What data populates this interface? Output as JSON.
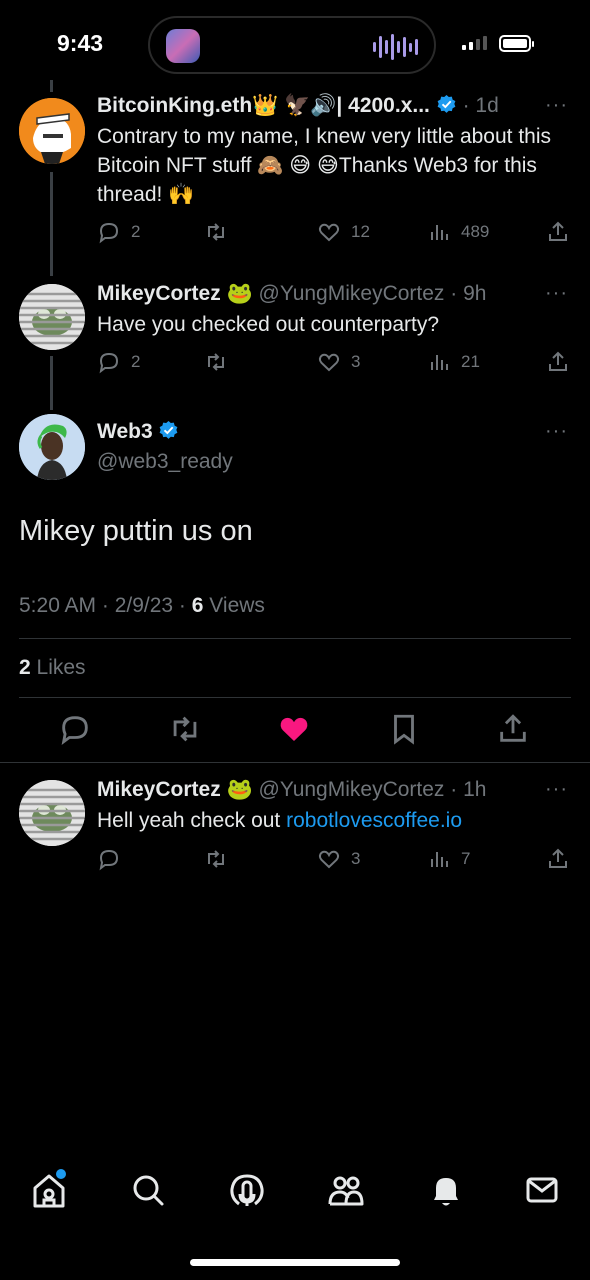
{
  "status_bar": {
    "time": "9:43"
  },
  "tweets": [
    {
      "name": "BitcoinKing.eth👑 🦅🔊| 4200.x...",
      "age": "· 1d",
      "text": "Contrary to my name, I knew very little about this Bitcoin NFT stuff 🙈 😅 😅Thanks Web3 for this thread! 🙌",
      "replies": "2",
      "retweets": "",
      "likes": "12",
      "views": "489"
    },
    {
      "name": "MikeyCortez 🐸",
      "handle": "@YungMikeyCortez · 9h",
      "text": "Have you checked out counterparty?",
      "replies": "2",
      "retweets": "",
      "likes": "3",
      "views": "21"
    }
  ],
  "focus": {
    "name": "Web3",
    "handle": "@web3_ready",
    "text": "Mikey puttin us on",
    "time_date": "5:20 AM · 2/9/23 · ",
    "views_count": "6",
    "views_label": " Views",
    "likes_count": "2",
    "likes_label": " Likes"
  },
  "reply": {
    "name": "MikeyCortez 🐸",
    "handle": "@YungMikeyCortez · 1h",
    "text_prefix": "Hell yeah check out ",
    "link": "robotlovescoffee.io",
    "replies": "",
    "retweets": "",
    "likes": "3",
    "views": "7"
  },
  "more_label": "···",
  "colors": {
    "accent": "#1d9bf0",
    "like_active": "#f91880",
    "muted": "#71767b",
    "divider": "#2f3336"
  },
  "icons": [
    "reply-icon",
    "retweet-icon",
    "like-icon",
    "views-icon",
    "share-icon",
    "bookmark-icon",
    "home-icon",
    "search-icon",
    "spaces-icon",
    "communities-icon",
    "notifications-icon",
    "messages-icon",
    "verified-badge-icon"
  ]
}
